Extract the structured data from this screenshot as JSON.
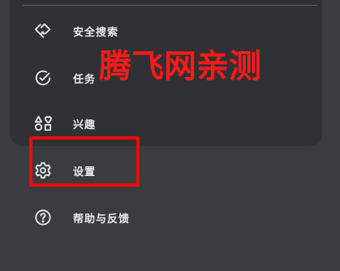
{
  "menu": {
    "items": [
      {
        "label": "安全搜索",
        "icon": "shield-hand-icon"
      },
      {
        "label": "任务",
        "icon": "check-circle-icon"
      },
      {
        "label": "兴趣",
        "icon": "shapes-interests-icon"
      },
      {
        "label": "设置",
        "icon": "gear-icon"
      },
      {
        "label": "帮助与反馈",
        "icon": "help-circle-icon"
      }
    ]
  },
  "overlay": {
    "watermark_text": "腾飞网亲测",
    "watermark_color": "#ff1a1a",
    "highlight_color": "#ee0a0a"
  },
  "colors": {
    "background": "#3b3c40",
    "card": "#303134",
    "text": "#e8eaed",
    "icon": "#e8eaed"
  }
}
